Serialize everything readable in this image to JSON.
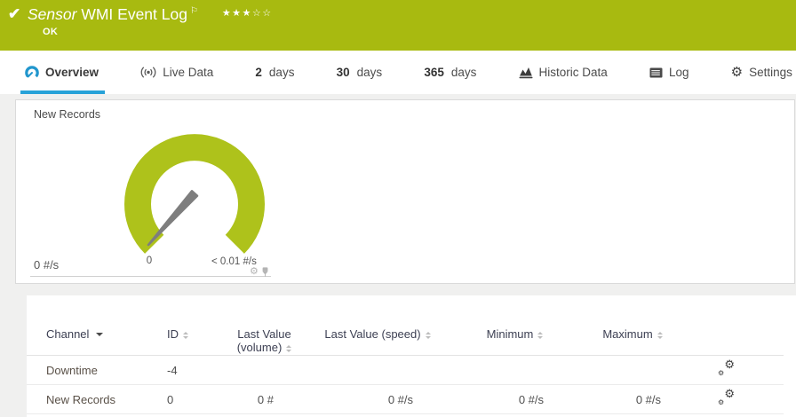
{
  "colors": {
    "header_background": "#a8ba10",
    "accent_blue": "#27a2d8",
    "gauge_green": "#aec21b",
    "needle_gray": "#7e7e7e"
  },
  "icons": {
    "check": "✔",
    "flag": "⚐",
    "gear": "⚙",
    "stars": "★★★☆☆"
  },
  "header": {
    "kind": "Sensor",
    "title": "WMI Event Log",
    "status": "OK",
    "rating_filled": 3,
    "rating_total": 5
  },
  "tabs": [
    {
      "label": "Overview",
      "icon": "gauge-icon",
      "active": true
    },
    {
      "label": "Live Data",
      "icon": "live-icon",
      "active": false
    },
    {
      "value": "2",
      "label": "days",
      "active": false
    },
    {
      "value": "30",
      "label": "days",
      "active": false
    },
    {
      "value": "365",
      "label": "days",
      "active": false
    },
    {
      "label": "Historic Data",
      "icon": "area-chart-icon",
      "active": false
    },
    {
      "label": "Log",
      "icon": "log-icon",
      "active": false
    },
    {
      "label": "Settings",
      "icon": "gear-icon",
      "active": false
    }
  ],
  "gauge_panel": {
    "title": "New Records",
    "current_value": "0 #/s",
    "scale_min_label": "0",
    "scale_max_label": "< 0.01 #/s"
  },
  "channel_table": {
    "columns": [
      {
        "label": "Channel",
        "sort": "sorted-desc"
      },
      {
        "label": "ID",
        "sort": "sortable"
      },
      {
        "label": "Last Value (volume)",
        "sort": "sortable"
      },
      {
        "label": "Last Value (speed)",
        "sort": "sortable"
      },
      {
        "label": "Minimum",
        "sort": "sortable"
      },
      {
        "label": "Maximum",
        "sort": "sortable"
      }
    ],
    "rows": [
      {
        "channel": "Downtime",
        "id": "-4",
        "last_value_volume": "",
        "last_value_speed": "",
        "minimum": "",
        "maximum": ""
      },
      {
        "channel": "New Records",
        "id": "0",
        "last_value_volume": "0 #",
        "last_value_speed": "0 #/s",
        "minimum": "0 #/s",
        "maximum": "0 #/s"
      }
    ]
  }
}
